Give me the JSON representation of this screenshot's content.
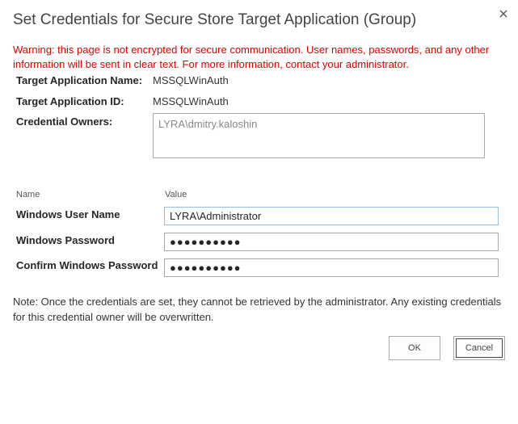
{
  "dialog": {
    "title": "Set Credentials for Secure Store Target Application (Group)",
    "close_icon": "close-icon"
  },
  "warning": "Warning: this page is not encrypted for secure communication. User names, passwords, and any other information will be sent in clear text. For more information, contact your administrator.",
  "info": {
    "app_name_label": "Target Application Name:",
    "app_name_value": "MSSQLWinAuth",
    "app_id_label": "Target Application ID:",
    "app_id_value": "MSSQLWinAuth",
    "owners_label": "Credential Owners:",
    "owners_value": "LYRA\\dmitry.kaloshin"
  },
  "fields": {
    "name_header": "Name",
    "value_header": "Value",
    "user_name_label": "Windows User Name",
    "user_name_value": "LYRA\\Administrator",
    "password_label": "Windows Password",
    "password_value": "●●●●●●●●●●",
    "confirm_label": "Confirm Windows Password",
    "confirm_value": "●●●●●●●●●●"
  },
  "note": "Note: Once the credentials are set, they cannot be retrieved by the administrator. Any existing credentials for this credential owner will be overwritten.",
  "buttons": {
    "ok": "OK",
    "cancel": "Cancel"
  },
  "colors": {
    "warning": "#e00000",
    "border": "#ababab",
    "focus_border": "#92c0e0"
  }
}
